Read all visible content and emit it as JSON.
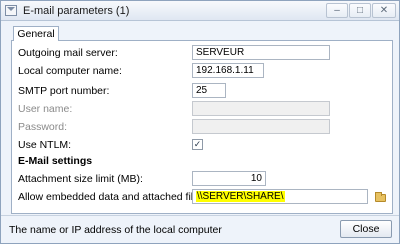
{
  "window": {
    "title": "E-mail parameters (1)",
    "controls": {
      "minimize": "–",
      "maximize": "□",
      "close": "✕"
    }
  },
  "tabs": [
    {
      "label": "General",
      "selected": true
    }
  ],
  "form": {
    "outgoing_mail_server": {
      "label": "Outgoing mail server:",
      "value": "SERVEUR"
    },
    "local_computer_name": {
      "label": "Local computer name:",
      "value": "192.168.1.11"
    },
    "smtp_port_number": {
      "label": "SMTP port number:",
      "value": "25"
    },
    "user_name": {
      "label": "User name:",
      "value": "",
      "enabled": false
    },
    "password": {
      "label": "Password:",
      "value": "",
      "enabled": false
    },
    "use_ntlm": {
      "label": "Use NTLM:",
      "checked": true,
      "mark": "✓"
    },
    "email_settings_heading": "E-Mail settings",
    "attachment_size_limit": {
      "label": "Attachment size limit (MB):",
      "value": "10"
    },
    "embedded_files_path": {
      "label": "Allow embedded data and attached files from:",
      "value": "\\\\SERVER\\SHARE\\"
    }
  },
  "status": {
    "text": "The name or IP address of the local computer",
    "close_label": "Close"
  },
  "icons": {
    "app": "window-icon",
    "browse": "folder-icon"
  },
  "colors": {
    "highlight": "#ffff00",
    "window_bg": "#eef3fa",
    "border": "#9fb0c6"
  }
}
